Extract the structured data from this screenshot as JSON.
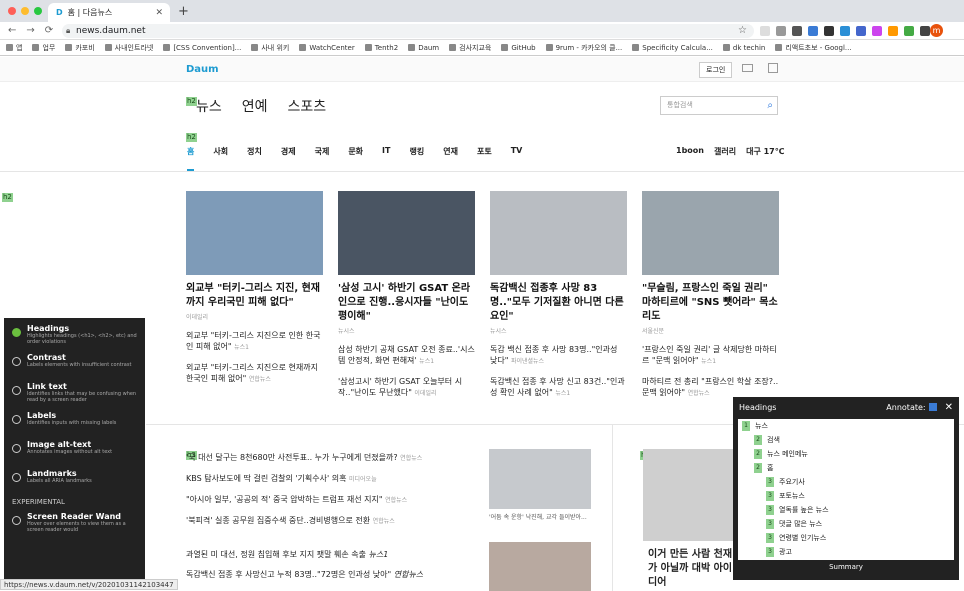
{
  "browser": {
    "tab_title": "홈 | 다음뉴스",
    "url": "news.daum.net",
    "status_url": "https://news.v.daum.net/v/20201031142103447",
    "profile_initial": "m"
  },
  "bookmarks": [
    "앱",
    "업무",
    "카포비",
    "사내인트라넷",
    "[CSS Convention]...",
    "사내 위키",
    "WatchCenter",
    "Tenth2",
    "Daum",
    "검사지교육",
    "GitHub",
    "9rum - 카카오의 클...",
    "Specificity Calcula...",
    "dk techin",
    "리액트초보 - Googl..."
  ],
  "site": {
    "logo": "Daum",
    "login": "로그인"
  },
  "sections": [
    "뉴스",
    "연예",
    "스포츠"
  ],
  "search": {
    "placeholder": "통합검색"
  },
  "menu": [
    "홈",
    "사회",
    "정치",
    "경제",
    "국제",
    "문화",
    "IT",
    "랭킹",
    "연재",
    "포토",
    "TV"
  ],
  "menu_right": [
    "1boon",
    "갤러리",
    "대구 17℃"
  ],
  "cards": [
    {
      "title": "외교부 \"터키-그리스 지진, 현재까지 우리국민 피해 없다\"",
      "source": "이데일리",
      "subs": [
        {
          "t": "외교부 \"터키-그리스 지진으로 인한 한국인 피해 없어\"",
          "s": "뉴스1"
        },
        {
          "t": "외교부 \"터키-그리스 지진으로 현재까지 한국인 피해 없어\"",
          "s": "연합뉴스"
        }
      ]
    },
    {
      "title": "'삼성 고시' 하반기 GSAT 온라인으로 진행..응시자들 \"난이도 평이해\"",
      "source": "뉴시스",
      "subs": [
        {
          "t": "삼성 하반기 공채 GSAT 오전 종료..'시스템 안정적, 화면 편해져'",
          "s": "뉴스1"
        },
        {
          "t": "'삼성고시' 하반기 GSAT 오늘부터 시작..\"난이도 무난했다\"",
          "s": "이데일리"
        }
      ]
    },
    {
      "title": "독감백신 접종후 사망 83명..\"모두 기저질환 아니면 다른 요인\"",
      "source": "뉴시스",
      "subs": [
        {
          "t": "독감 백신 접종 후 사망 83명..\"인과성 낮다\"",
          "s": "파이낸셜뉴스"
        },
        {
          "t": "독감백신 접종 후 사망 신고 83건..\"인과성 확인 사례 없어\"",
          "s": "뉴스1"
        }
      ]
    },
    {
      "title": "\"무슬림, 프랑스인 죽일 권리\" 마하티르에 \"SNS 뺏어라\" 목소리도",
      "source": "서울신문",
      "subs": [
        {
          "t": "'프랑스인 죽일 권리' 글 삭제당한 마하티르 \"문맥 읽어야\"",
          "s": "뉴스1"
        },
        {
          "t": "마하티르 전 총리 \"프랑스인 학살 조장?..문맥 읽어야\"",
          "s": "연합뉴스"
        }
      ]
    }
  ],
  "list": [
    {
      "t": "'국 대선 달구는 8천680만 사전투표.. 누가 누구에게 던졌을까?",
      "s": "연합뉴스"
    },
    {
      "t": "KBS 탐사보도에 딱 걸린 검찰의 '기획수사' 의혹",
      "s": "미디어오늘"
    },
    {
      "t": "\"아시아 일부, '공공의 적' 중국 압박하는 트럼프 재선 지지\"",
      "s": "연합뉴스"
    },
    {
      "t": "'북피격' 실종 공무원 집중수색 중단..경비병행으로 전환",
      "s": "연합뉴스"
    }
  ],
  "list2": [
    {
      "t": "과열된 미 대선, 정원 침입해 후보 지지 팻말 훼손 속출",
      "s": "뉴스1"
    },
    {
      "t": "독감백신 접종 후 사망신고 누적 83명..\"72명은 인과성 낮아\"",
      "s": "연합뉴스"
    }
  ],
  "photo_caption": "'어둠 속 운항' 낙진해, 교각 들이받아...",
  "feature_title": "이거 만든 사람 천재가 아닐까 대박 아이디어",
  "a11y_panel": {
    "items": [
      {
        "label": "Headings",
        "desc": "Highlights headings (<h1>, <h2>, etc) and order violations",
        "on": true
      },
      {
        "label": "Contrast",
        "desc": "Labels elements with insufficient contrast",
        "on": false
      },
      {
        "label": "Link text",
        "desc": "Identifies links that may be confusing when read by a screen reader",
        "on": false
      },
      {
        "label": "Labels",
        "desc": "Identifies inputs with missing labels",
        "on": false
      },
      {
        "label": "Image alt-text",
        "desc": "Annotates images without alt text",
        "on": false
      },
      {
        "label": "Landmarks",
        "desc": "Labels all ARIA landmarks",
        "on": false
      }
    ],
    "experimental": "EXPERIMENTAL",
    "wand": {
      "label": "Screen Reader Wand",
      "desc": "Hover over elements to view them as a screen reader would"
    }
  },
  "headings_panel": {
    "title": "Headings",
    "annotate": "Annotate:",
    "summary": "Summary",
    "rows": [
      {
        "lv": "1",
        "t": "뉴스"
      },
      {
        "lv": "2",
        "t": "검색"
      },
      {
        "lv": "2",
        "t": "뉴스 메인메뉴"
      },
      {
        "lv": "2",
        "t": "홈"
      },
      {
        "lv": "3",
        "t": "주요기사"
      },
      {
        "lv": "3",
        "t": "포토뉴스"
      },
      {
        "lv": "3",
        "t": "열독률 높은 뉴스"
      },
      {
        "lv": "3",
        "t": "댓글 많은 뉴스"
      },
      {
        "lv": "3",
        "t": "연령별 인기뉴스"
      },
      {
        "lv": "3",
        "t": "광고"
      }
    ]
  }
}
